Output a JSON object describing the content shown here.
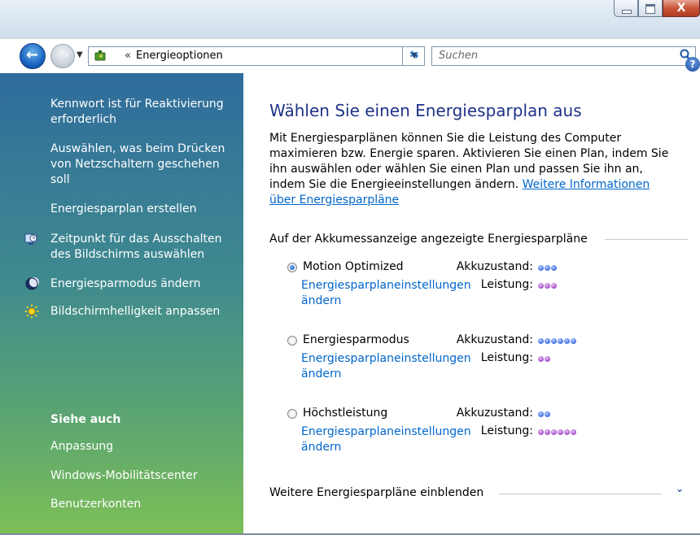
{
  "window": {
    "close_glyph": "X"
  },
  "navigation": {
    "address_separator": "«",
    "address_text": "Energieoptionen",
    "search_placeholder": "Suchen",
    "icons": [
      "back-arrow-icon",
      "forward-arrow-icon",
      "energy-options-icon",
      "refresh-icon",
      "search-icon",
      "help-icon"
    ]
  },
  "sidebar": {
    "tasks": [
      {
        "label": "Kennwort ist für Reaktivierung erforderlich",
        "icon": null
      },
      {
        "label": "Auswählen, was beim Drücken von Netzschaltern geschehen soll",
        "icon": null
      },
      {
        "label": "Energiesparplan erstellen",
        "icon": null
      },
      {
        "label": "Zeitpunkt für das Ausschalten des Bildschirms auswählen",
        "icon": "monitor-icon"
      },
      {
        "label": "Energiesparmodus ändern",
        "icon": "moon-icon"
      },
      {
        "label": "Bildschirmhelligkeit anpassen",
        "icon": "sun-icon"
      }
    ],
    "see_also": {
      "heading": "Siehe auch",
      "items": [
        "Anpassung",
        "Windows-Mobilitätscenter",
        "Benutzerkonten"
      ]
    }
  },
  "main": {
    "title": "Wählen Sie einen Energiesparplan aus",
    "intro_text": "Mit Energiesparplänen können Sie die Leistung des Computer maximieren bzw. Energie sparen. Aktivieren Sie einen Plan, indem Sie ihn auswählen oder wählen Sie einen Plan und passen Sie ihn an, indem Sie die Energieeinstellungen ändern.",
    "intro_link": "Weitere Informationen über Energiesparpläne",
    "section_heading": "Auf der Akkumessanzeige angezeigte Energiesparpläne",
    "battery_label": "Akkuzustand:",
    "performance_label": "Leistung:",
    "plans": [
      {
        "name": "Motion Optimized",
        "selected": true,
        "link": "Energiesparplaneinstellungen ändern",
        "battery_level": 3,
        "performance_level": 3
      },
      {
        "name": "Energiesparmodus",
        "selected": false,
        "link": "Energiesparplaneinstellungen ändern",
        "battery_level": 6,
        "performance_level": 2
      },
      {
        "name": "Höchstleistung",
        "selected": false,
        "link": "Energiesparplaneinstellungen ändern",
        "battery_level": 2,
        "performance_level": 6
      }
    ],
    "more_plans": "Weitere Energiesparpläne einblenden"
  },
  "colors": {
    "title_blue": "#1e3287",
    "link_blue": "#0066cc",
    "battery_dot": "#3a6ae5",
    "performance_dot": "#a14ac5"
  }
}
